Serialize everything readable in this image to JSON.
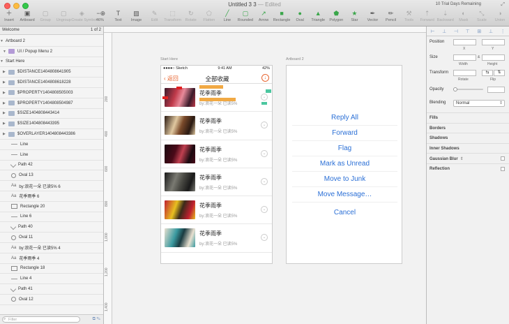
{
  "window": {
    "title": "Untitled 3 3",
    "edited": "— Edited",
    "trial": "10 Trial Days Remaining"
  },
  "toolbar": {
    "buttons": [
      {
        "label": "Insert",
        "icon": "plus-icon"
      },
      {
        "label": "Artboard",
        "icon": "artboard-icon"
      },
      {
        "label": "Group",
        "icon": "group-icon"
      },
      {
        "label": "Ungroup",
        "icon": "ungroup-icon"
      },
      {
        "label": "Create Symbol",
        "icon": "symbol-icon"
      },
      {
        "label": "46%",
        "icon": "zoom-icon"
      },
      {
        "label": "Text",
        "icon": "text-icon"
      },
      {
        "label": "Image",
        "icon": "image-icon"
      },
      {
        "label": "Edit",
        "icon": "edit-icon"
      },
      {
        "label": "Transform",
        "icon": "transform-icon"
      },
      {
        "label": "Rotate",
        "icon": "rotate-icon"
      },
      {
        "label": "Flatten",
        "icon": "flatten-icon"
      },
      {
        "label": "Line",
        "icon": "line-icon"
      },
      {
        "label": "Rounded",
        "icon": "rounded-icon"
      },
      {
        "label": "Arrow",
        "icon": "arrow-icon"
      },
      {
        "label": "Rectangle",
        "icon": "rectangle-icon"
      },
      {
        "label": "Oval",
        "icon": "oval-icon"
      },
      {
        "label": "Triangle",
        "icon": "triangle-icon"
      },
      {
        "label": "Polygon",
        "icon": "polygon-icon"
      },
      {
        "label": "Star",
        "icon": "star-icon"
      },
      {
        "label": "Vector",
        "icon": "vector-icon"
      },
      {
        "label": "Pencil",
        "icon": "pencil-icon"
      },
      {
        "label": "Tools",
        "icon": "tools-icon"
      },
      {
        "label": "Forward",
        "icon": "forward-icon"
      },
      {
        "label": "Backward",
        "icon": "backward-icon"
      },
      {
        "label": "Mask",
        "icon": "mask-icon"
      },
      {
        "label": "Scale",
        "icon": "scale-icon"
      },
      {
        "label": "Union",
        "icon": "union-icon"
      }
    ]
  },
  "layers": {
    "page_name": "Welcome",
    "page_count": "1 of 2",
    "filter_placeholder": "Filter",
    "items": [
      {
        "label": "Artboard 2",
        "type": "artboard",
        "depth": 0
      },
      {
        "label": "UI / Popup Menu 2",
        "type": "symbol",
        "depth": 1
      },
      {
        "label": "Start Here",
        "type": "artboard",
        "depth": 0
      },
      {
        "label": "$DISTANCE1404808641905",
        "type": "folder",
        "depth": 1
      },
      {
        "label": "$DISTANCE1404808618228",
        "type": "folder",
        "depth": 1
      },
      {
        "label": "$PROPERTY1404808505003",
        "type": "folder",
        "depth": 1
      },
      {
        "label": "$PROPERTY1404808504987",
        "type": "folder",
        "depth": 1
      },
      {
        "label": "$SIZE1404808443414",
        "type": "folder",
        "depth": 1
      },
      {
        "label": "$SIZE1404808443395",
        "type": "folder",
        "depth": 1
      },
      {
        "label": "$OVERLAYER1404808443386",
        "type": "folder",
        "depth": 1
      },
      {
        "label": "Line",
        "type": "line",
        "depth": 2
      },
      {
        "label": "Line",
        "type": "line",
        "depth": 2
      },
      {
        "label": "Path 42",
        "type": "path",
        "depth": 2
      },
      {
        "label": "Oval 13",
        "type": "oval",
        "depth": 2
      },
      {
        "label": "by:浪花一朵     已读5% 6",
        "type": "text",
        "depth": 2
      },
      {
        "label": "花季雨季 6",
        "type": "text",
        "depth": 2
      },
      {
        "label": "Rectangle 20",
        "type": "rect",
        "depth": 2
      },
      {
        "label": "Line 6",
        "type": "line",
        "depth": 2
      },
      {
        "label": "Path 40",
        "type": "path",
        "depth": 2
      },
      {
        "label": "Oval 11",
        "type": "oval",
        "depth": 2
      },
      {
        "label": "by:浪花一朵     已读5% 4",
        "type": "text",
        "depth": 2
      },
      {
        "label": "花季雨季 4",
        "type": "text",
        "depth": 2
      },
      {
        "label": "Rectangle 18",
        "type": "rect",
        "depth": 2
      },
      {
        "label": "Line 4",
        "type": "line",
        "depth": 2
      },
      {
        "label": "Path 41",
        "type": "path",
        "depth": 2
      },
      {
        "label": "Oval 12",
        "type": "oval",
        "depth": 2
      }
    ]
  },
  "canvas": {
    "ruler_marks": [
      "200",
      "400",
      "600",
      "800",
      "1,000",
      "1,200",
      "1,400"
    ],
    "artboard1_label": "Start Here",
    "artboard2_label": "Artboard 2",
    "phone": {
      "carrier": "●●●●○ Sketch",
      "time": "9:41 AM",
      "battery": "42%",
      "back": "返回",
      "title": "全部收藏",
      "download_glyph": "↓",
      "rows": [
        {
          "song": "花季雨季",
          "meta": "by:浪花一朵   已读5%",
          "colors": [
            "#c03a4a",
            "#3a1a2a",
            "#e88a9a"
          ]
        },
        {
          "song": "花季雨季",
          "meta": "by:浪花一朵   已读5%",
          "colors": [
            "#e0c8a0",
            "#2a1a12",
            "#7a4a2a"
          ]
        },
        {
          "song": "花季雨季",
          "meta": "by:浪花一朵   已读5%",
          "colors": [
            "#4a0a18",
            "#1a0a10",
            "#c04050"
          ]
        },
        {
          "song": "花季雨季",
          "meta": "by:浪花一朵   已读5%",
          "colors": [
            "#7a7a72",
            "#1a1a1a",
            "#4a4a44"
          ]
        },
        {
          "song": "花季雨季",
          "meta": "by:浪花一朵   已读5%",
          "colors": [
            "#e8c020",
            "#c02030",
            "#3a2a1a"
          ]
        },
        {
          "song": "花季雨季",
          "meta": "by:浪花一朵   已读5%",
          "colors": [
            "#3a9aa0",
            "#e8e0d0",
            "#1a3a40"
          ]
        }
      ]
    },
    "sheet": {
      "items": [
        "Reply All",
        "Forward",
        "Flag",
        "Mark as Unread",
        "Move to Junk",
        "Move Message…"
      ],
      "cancel": "Cancel"
    }
  },
  "inspector": {
    "position": "Position",
    "x": "X",
    "y": "Y",
    "size": "Size",
    "width": "Width",
    "height": "Height",
    "transform": "Transform",
    "rotate": "Rotate",
    "flip": "Flip",
    "opacity": "Opacity",
    "blending": "Blending",
    "blending_value": "Normal",
    "sections": [
      "Fills",
      "Borders",
      "Shadows",
      "Inner Shadows",
      "Gaussian Blur",
      "Reflection"
    ]
  },
  "colors": {
    "accent_orange": "#e8632e",
    "link_blue": "#2a6fd6"
  }
}
